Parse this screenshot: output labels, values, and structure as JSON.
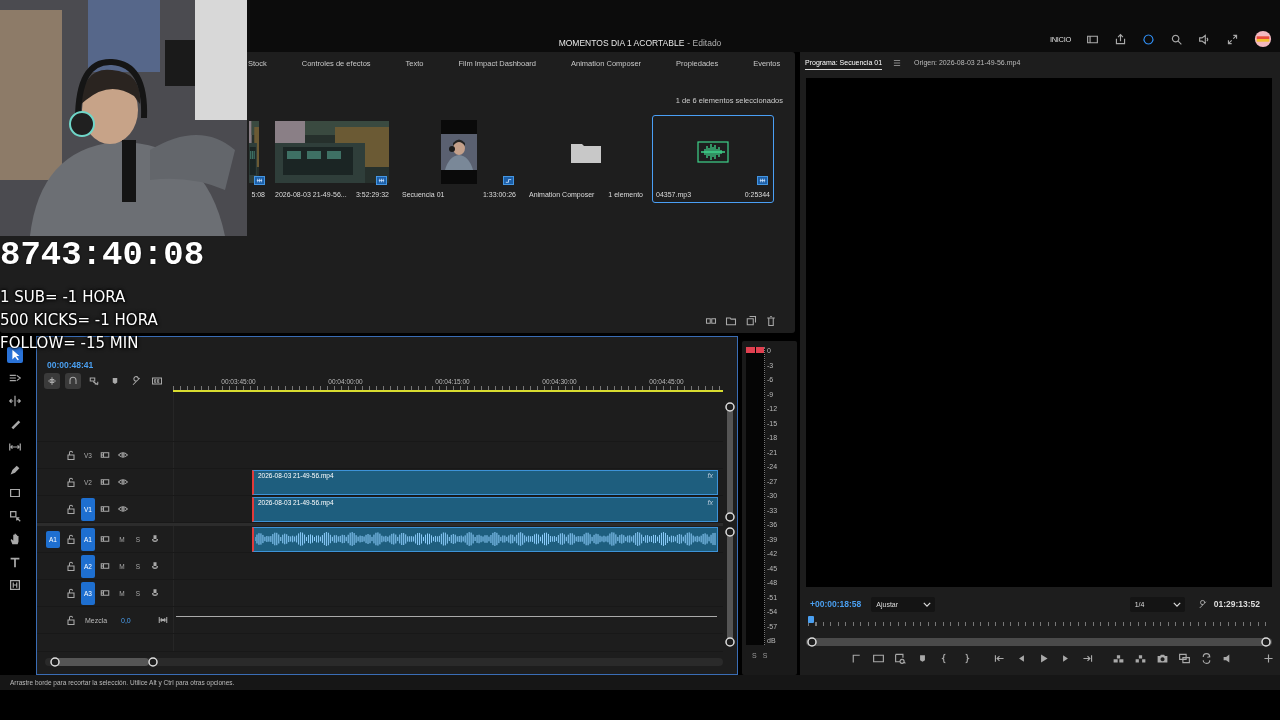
{
  "title_bar": {
    "title": "MOMENTOS DIA 1 ACORTABLE",
    "status": "- Editado",
    "workspace": "INICIO"
  },
  "stream_overlay": {
    "timer": "8743:40:08",
    "rules": [
      "1 SUB= -1 HORA",
      "500 KICKS= -1 HORA",
      "FOLLOW= -15 MIN"
    ]
  },
  "project": {
    "tabs": [
      {
        "label": "Stock",
        "selected": false
      },
      {
        "label": "Controles de efectos",
        "selected": false
      },
      {
        "label": "Texto",
        "selected": false
      },
      {
        "label": "Film Impact Dashboard",
        "selected": false
      },
      {
        "label": "Animation Composer",
        "selected": false
      },
      {
        "label": "Propiedades",
        "selected": false
      },
      {
        "label": "Eventos",
        "selected": false
      }
    ],
    "selection_info": "1 de 6 elementos seleccionados",
    "items": [
      {
        "kind": "video",
        "duration": "5:08",
        "selected": false
      },
      {
        "kind": "video",
        "name": "2026-08-03 21-49-56...",
        "duration": "3:52:29:32",
        "selected": false
      },
      {
        "kind": "sequence",
        "name": "Secuencia 01",
        "duration": "1:33:00:26",
        "selected": false
      },
      {
        "kind": "bin",
        "name": "Animation Composer",
        "duration": "1 elemento",
        "selected": false
      },
      {
        "kind": "audio",
        "name": "04357.mp3",
        "duration": "0:25344",
        "selected": true
      }
    ]
  },
  "timeline": {
    "timecode": "00:00:48:41",
    "ruler": [
      "00:03:45:00",
      "00:04:00:00",
      "00:04:15:00",
      "00:04:30:00",
      "00:04:45:00"
    ],
    "tracks": [
      {
        "kind": "video",
        "name": "V3",
        "targeted": false
      },
      {
        "kind": "video",
        "name": "V2",
        "targeted": false,
        "clip": {
          "kind": "video",
          "name": "2026-08-03 21-49-56.mp4",
          "effect": "fx"
        }
      },
      {
        "kind": "video",
        "name": "V1",
        "targeted": true,
        "clip": {
          "kind": "video",
          "name": "2026-08-03 21-49-56.mp4",
          "effect": "fx"
        }
      },
      {
        "kind": "audio",
        "source": "A1",
        "name": "A1",
        "targeted": true,
        "mute": "M",
        "solo": "S",
        "clip": {
          "kind": "waveform"
        }
      },
      {
        "kind": "audio",
        "name": "A2",
        "targeted": true,
        "mute": "M",
        "solo": "S"
      },
      {
        "kind": "audio",
        "name": "A3",
        "targeted": true,
        "mute": "M",
        "solo": "S"
      },
      {
        "kind": "mix",
        "name": "Mezcla",
        "value": "0,0"
      }
    ]
  },
  "meter": {
    "scale": [
      "0",
      "-3",
      "-6",
      "-9",
      "-12",
      "-15",
      "-18",
      "-21",
      "-24",
      "-27",
      "-30",
      "-33",
      "-36",
      "-39",
      "-42",
      "-45",
      "-48",
      "-51",
      "-54",
      "-57",
      "dB"
    ],
    "channels": [
      "S",
      "S"
    ]
  },
  "program": {
    "tabs": [
      {
        "label": "Programa: Secuencia 01",
        "selected": true
      },
      {
        "label": "Origen: 2026-08-03 21-49-56.mp4",
        "selected": false
      }
    ],
    "timecode": "+00:00:18:58",
    "zoom": "Ajustar",
    "resolution": "1/4",
    "duration": "01:29:13:52"
  },
  "status_bar": "Arrastre borde para recortar la selección. Utilice Alt y Ctrl para otras opciones."
}
